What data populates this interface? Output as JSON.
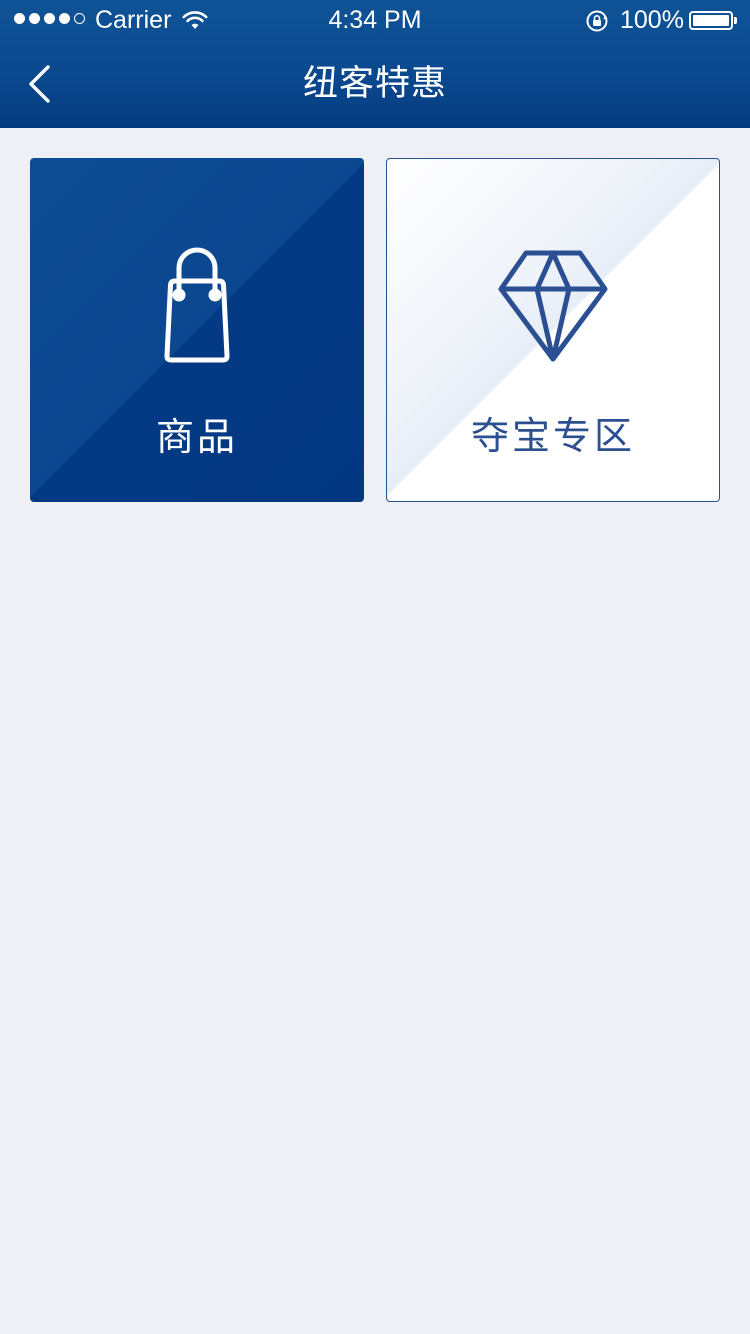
{
  "status_bar": {
    "carrier": "Carrier",
    "time": "4:34 PM",
    "battery": "100%",
    "signal_bars_filled": 4,
    "signal_bars_total": 5
  },
  "nav": {
    "title": "纽客特惠",
    "back_icon": "chevron-left-icon"
  },
  "tiles": [
    {
      "label": "商品",
      "icon": "shopping-bag-icon",
      "bg": "#0b4790",
      "fg": "#ffffff"
    },
    {
      "label": "夺宝专区",
      "icon": "diamond-icon",
      "bg": "#ffffff",
      "fg": "#2c4f8f"
    }
  ],
  "colors": {
    "header": "#0b4a8f",
    "page_background": "#eef0f5",
    "accent_blue": "#2a4f92"
  }
}
